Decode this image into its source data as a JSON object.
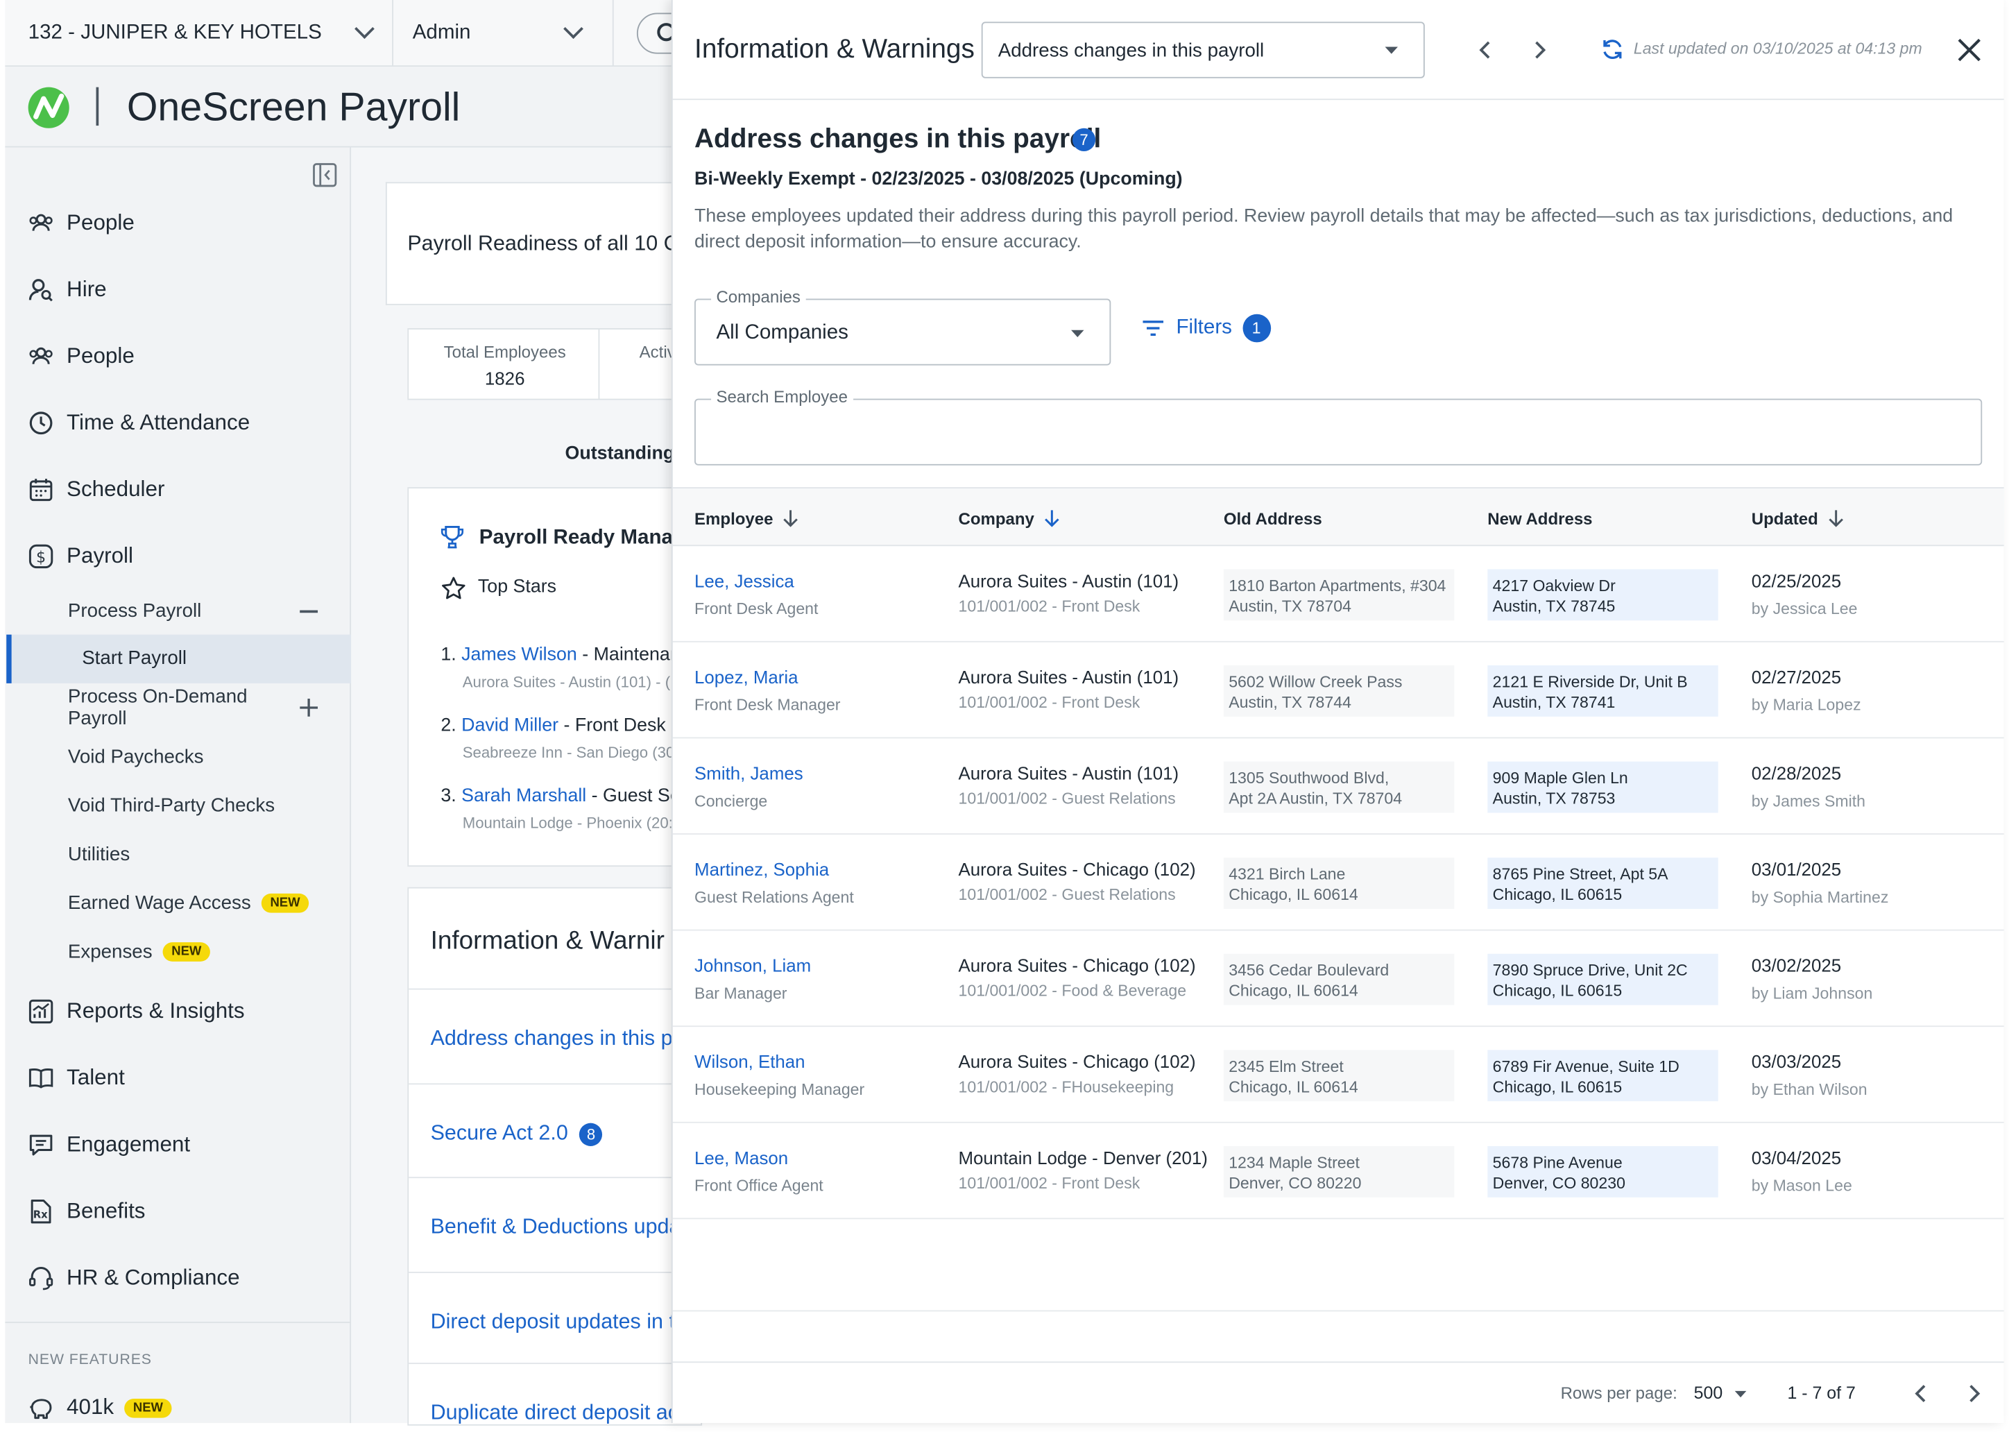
{
  "topbar": {
    "company": "132 - JUNIPER & KEY HOTELS",
    "role": "Admin"
  },
  "brand": {
    "name": "OneScreen Payroll"
  },
  "sidebar": {
    "items": [
      {
        "label": "People",
        "icon": "people-icon"
      },
      {
        "label": "Hire",
        "icon": "hire-icon"
      },
      {
        "label": "People",
        "icon": "people-icon"
      },
      {
        "label": "Time & Attendance",
        "icon": "clock-icon"
      },
      {
        "label": "Scheduler",
        "icon": "calendar-icon"
      },
      {
        "label": "Payroll",
        "icon": "dollar-icon"
      }
    ],
    "payroll_sub": [
      {
        "label": "Process Payroll",
        "control": "collapse"
      },
      {
        "label": "Start Payroll",
        "selected": true
      },
      {
        "label": "Process On-Demand Payroll",
        "control": "expand"
      },
      {
        "label": "Void Paychecks"
      },
      {
        "label": "Void Third-Party Checks"
      },
      {
        "label": "Utilities"
      },
      {
        "label": "Earned Wage Access",
        "badge": "NEW"
      },
      {
        "label": "Expenses",
        "badge": "NEW"
      }
    ],
    "items2": [
      {
        "label": "Reports & Insights",
        "icon": "chart-icon"
      },
      {
        "label": "Talent",
        "icon": "book-icon"
      },
      {
        "label": "Engagement",
        "icon": "chat-icon"
      },
      {
        "label": "Benefits",
        "icon": "benefits-icon"
      },
      {
        "label": "HR & Compliance",
        "icon": "headset-icon"
      }
    ],
    "new_features_label": "NEW FEATURES",
    "feature": {
      "label": "401k",
      "badge": "NEW"
    }
  },
  "background": {
    "readiness_title": "Payroll Readiness of all 10 Co",
    "total_employees_label": "Total Employees",
    "total_employees_value": "1826",
    "active_label": "Activ",
    "outstanding_label": "Outstanding",
    "ready_title": "Payroll Ready Manag",
    "top_stars_label": "Top Stars",
    "stars": [
      {
        "num": "1.",
        "name": "James Wilson",
        "rest": " - Maintenar",
        "sub": "Aurora Suites - Austin (101) - ("
      },
      {
        "num": "2.",
        "name": "David Miller",
        "rest": " - Front Desk I",
        "sub": "Seabreeze Inn - San Diego (303"
      },
      {
        "num": "3.",
        "name": "Sarah Marshall",
        "rest": " - Guest Se",
        "sub": "Mountain Lodge - Phoenix (20:"
      }
    ],
    "info_title": "Information & Warnir",
    "info_links": [
      {
        "label": "Address changes in this pa"
      },
      {
        "label": "Secure Act 2.0",
        "badge": "8"
      },
      {
        "label": "Benefit & Deductions upda"
      },
      {
        "label": "Direct deposit updates in t"
      },
      {
        "label": "Duplicate direct deposit ac"
      }
    ]
  },
  "panel": {
    "title": "Information & Warnings",
    "dropdown": "Address changes in this payroll",
    "last_updated": "Last updated on 03/10/2025 at 04:13 pm",
    "heading": "Address changes in this payroll",
    "count": "7",
    "period": "Bi-Weekly Exempt - 02/23/2025 - 03/08/2025 (Upcoming)",
    "description": "These employees updated their address during this payroll period. Review payroll details that may be affected—such as tax jurisdictions, deductions, and direct deposit information—to ensure accuracy.",
    "companies_label": "Companies",
    "companies_value": "All Companies",
    "filters_label": "Filters",
    "filters_count": "1",
    "search_label": "Search Employee",
    "search_value": "",
    "columns": {
      "employee": "Employee",
      "company": "Company",
      "old_address": "Old Address",
      "new_address": "New Address",
      "updated": "Updated"
    },
    "rows": [
      {
        "employee": "Lee, Jessica",
        "role": "Front Desk Agent",
        "company": "Aurora Suites - Austin (101)",
        "code": "101/001/002 - Front Desk",
        "old1": "1810 Barton Apartments, #304",
        "old2": "Austin, TX 78704",
        "new1": "4217 Oakview Dr",
        "new2": "Austin, TX 78745",
        "date": "02/25/2025",
        "by": "by Jessica Lee"
      },
      {
        "employee": "Lopez, Maria",
        "role": "Front Desk Manager",
        "company": "Aurora Suites - Austin (101)",
        "code": "101/001/002 - Front Desk",
        "old1": "5602 Willow Creek Pass",
        "old2": "Austin, TX 78744",
        "new1": "2121 E Riverside Dr, Unit B",
        "new2": "Austin, TX 78741",
        "date": "02/27/2025",
        "by": "by Maria Lopez"
      },
      {
        "employee": "Smith, James",
        "role": "Concierge",
        "company": "Aurora Suites - Austin (101)",
        "code": "101/001/002 - Guest Relations",
        "old1": "1305 Southwood Blvd,",
        "old2": "Apt 2A Austin, TX 78704",
        "new1": "909 Maple Glen Ln",
        "new2": "Austin, TX 78753",
        "date": "02/28/2025",
        "by": "by James Smith"
      },
      {
        "employee": "Martinez, Sophia",
        "role": "Guest Relations Agent",
        "company": "Aurora Suites - Chicago (102)",
        "code": "101/001/002 - Guest Relations",
        "old1": "4321 Birch Lane",
        "old2": "Chicago, IL 60614",
        "new1": "8765 Pine Street, Apt 5A",
        "new2": "Chicago, IL 60615",
        "date": "03/01/2025",
        "by": "by Sophia Martinez"
      },
      {
        "employee": "Johnson, Liam",
        "role": "Bar Manager",
        "company": "Aurora Suites - Chicago (102)",
        "code": "101/001/002 - Food & Beverage",
        "old1": "3456 Cedar Boulevard",
        "old2": "Chicago, IL 60614",
        "new1": "7890 Spruce Drive, Unit 2C",
        "new2": "Chicago, IL 60615",
        "date": "03/02/2025",
        "by": "by Liam Johnson"
      },
      {
        "employee": "Wilson, Ethan",
        "role": "Housekeeping Manager",
        "company": "Aurora Suites - Chicago (102)",
        "code": "101/001/002 - FHousekeeping",
        "old1": "2345 Elm Street",
        "old2": "Chicago, IL 60614",
        "new1": "6789 Fir Avenue, Suite 1D",
        "new2": "Chicago, IL 60615",
        "date": "03/03/2025",
        "by": "by Ethan Wilson"
      },
      {
        "employee": "Lee, Mason",
        "role": "Front Office Agent",
        "company": "Mountain Lodge - Denver (201)",
        "code": "101/001/002 - Front Desk",
        "old1": "1234 Maple Street",
        "old2": "Denver, CO 80220",
        "new1": "5678 Pine Avenue",
        "new2": "Denver, CO 80230",
        "date": "03/04/2025",
        "by": "by Mason Lee"
      }
    ],
    "pagination": {
      "rows_label": "Rows per page:",
      "rows_value": "500",
      "range": "1 - 7 of 7"
    }
  },
  "colors": {
    "accent": "#1a63c9",
    "badge": "#1a63c9",
    "new_badge": "#f5d90a",
    "brand_green": "#4cc04a"
  }
}
